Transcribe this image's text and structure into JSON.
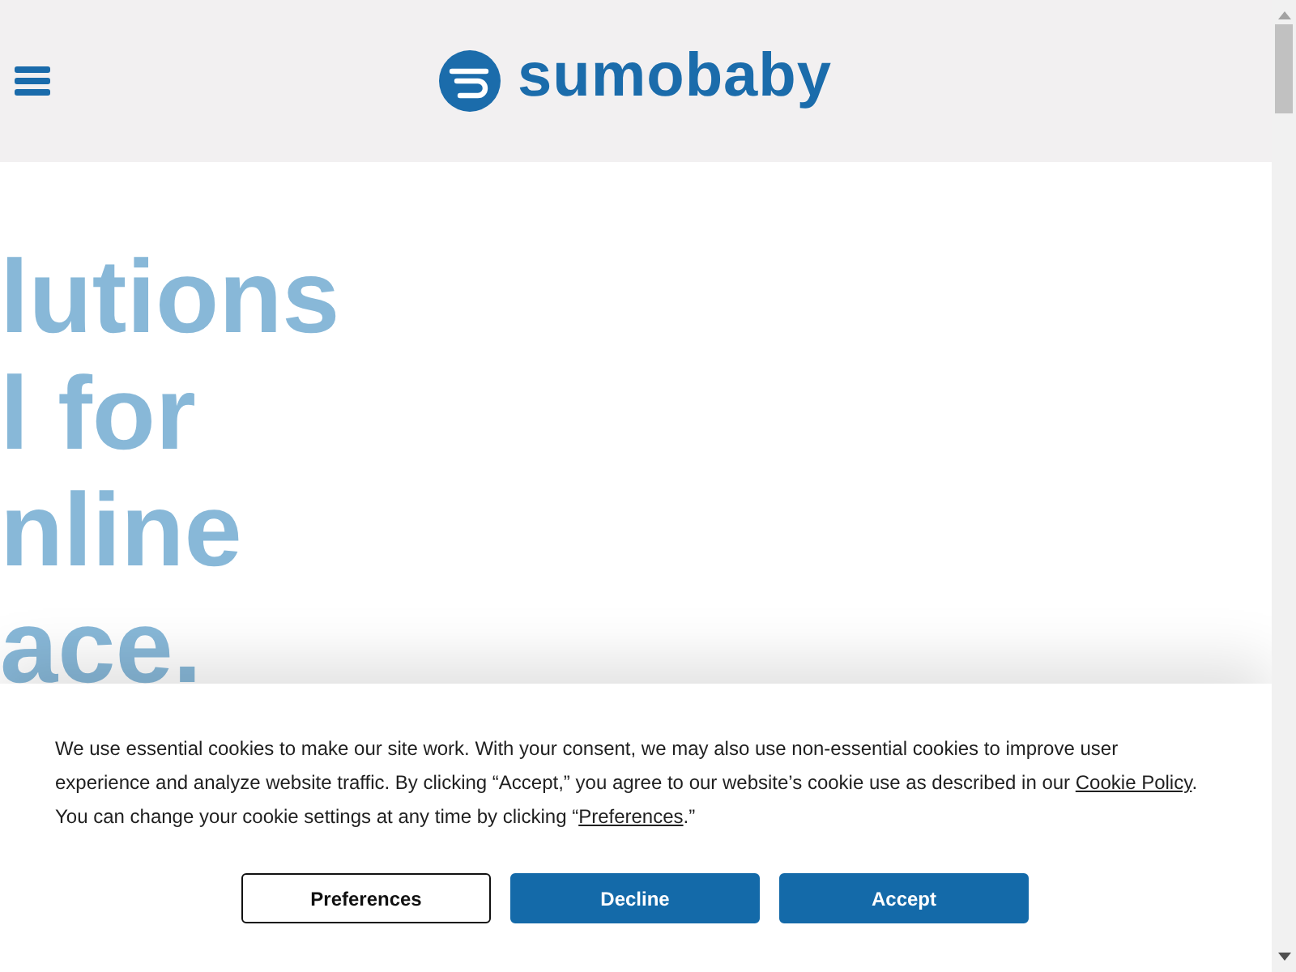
{
  "header": {
    "logo": {
      "wordmark": "sumobaby"
    }
  },
  "hero": {
    "headline_lines": [
      "lutions",
      "l for",
      "nline",
      "ace."
    ]
  },
  "cookie_banner": {
    "message": [
      {
        "kind": "text",
        "text": "We use essential cookies to make our site work. With your consent, we may also use non-essential cookies to improve user experience and analyze website traffic. By clicking “Accept,” you agree to our website’s cookie use as described in our "
      },
      {
        "kind": "link",
        "text": "Cookie Policy"
      },
      {
        "kind": "text",
        "text": ". You can change your cookie settings at any time by clicking “"
      },
      {
        "kind": "link",
        "text": "Preferences"
      },
      {
        "kind": "text",
        "text": ".”"
      }
    ],
    "buttons": [
      {
        "label": "Preferences",
        "kind": "outline"
      },
      {
        "label": "Decline",
        "kind": "filled"
      },
      {
        "label": "Accept",
        "kind": "filled"
      }
    ]
  }
}
